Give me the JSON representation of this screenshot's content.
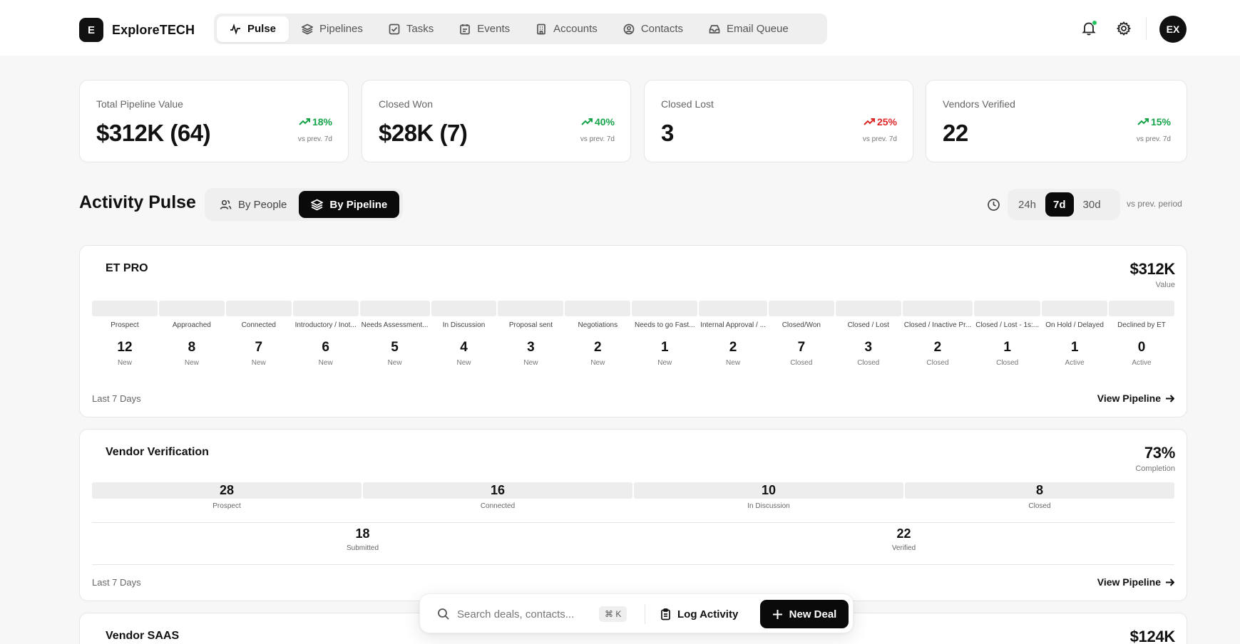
{
  "brand": {
    "logo_letter": "E",
    "name": "ExploreTECH"
  },
  "nav": [
    {
      "label": "Pulse",
      "icon": "pulse-icon",
      "active": true
    },
    {
      "label": "Pipelines",
      "icon": "layers-icon"
    },
    {
      "label": "Tasks",
      "icon": "checkbox-icon"
    },
    {
      "label": "Events",
      "icon": "calendar-icon"
    },
    {
      "label": "Accounts",
      "icon": "building-icon"
    },
    {
      "label": "Contacts",
      "icon": "contact-icon"
    },
    {
      "label": "Email Queue",
      "icon": "inbox-icon"
    }
  ],
  "header": {
    "avatar_initials": "EX",
    "icons": [
      "bell-icon",
      "gear-icon"
    ]
  },
  "kpis": [
    {
      "label": "Total Pipeline Value",
      "value": "$312K (64)",
      "trend": "18%",
      "direction": "up",
      "compare": "vs prev. 7d"
    },
    {
      "label": "Closed Won",
      "value": "$28K (7)",
      "trend": "40%",
      "direction": "up",
      "compare": "vs prev. 7d"
    },
    {
      "label": "Closed Lost",
      "value": "3",
      "trend": "25%",
      "direction": "down",
      "compare": "vs prev. 7d"
    },
    {
      "label": "Vendors Verified",
      "value": "22",
      "trend": "15%",
      "direction": "up",
      "compare": "vs prev. 7d"
    }
  ],
  "activity": {
    "title": "Activity Pulse",
    "view_toggle": [
      {
        "label": "By People",
        "icon": "people-icon",
        "active": false
      },
      {
        "label": "By Pipeline",
        "icon": "layers-icon",
        "active": true
      }
    ],
    "ranges": [
      {
        "label": "24h",
        "active": false
      },
      {
        "label": "7d",
        "active": true
      },
      {
        "label": "30d",
        "active": false
      }
    ],
    "range_note": "vs prev. period"
  },
  "pipelines": {
    "et_pro": {
      "title": "ET PRO",
      "metric_value": "$312K",
      "metric_label": "Value",
      "stages": [
        {
          "name": "Prospect",
          "count": "12",
          "status": "New"
        },
        {
          "name": "Approached",
          "count": "8",
          "status": "New"
        },
        {
          "name": "Connected",
          "count": "7",
          "status": "New"
        },
        {
          "name": "Introductory / Inot...",
          "count": "6",
          "status": "New"
        },
        {
          "name": "Needs Assessment...",
          "count": "5",
          "status": "New"
        },
        {
          "name": "In Discussion",
          "count": "4",
          "status": "New"
        },
        {
          "name": "Proposal sent",
          "count": "3",
          "status": "New"
        },
        {
          "name": "Negotiations",
          "count": "2",
          "status": "New"
        },
        {
          "name": "Needs to go Fast...",
          "count": "1",
          "status": "New"
        },
        {
          "name": "Internal Approval / ...",
          "count": "2",
          "status": "New"
        },
        {
          "name": "Closed/Won",
          "count": "7",
          "status": "Closed"
        },
        {
          "name": "Closed / Lost",
          "count": "3",
          "status": "Closed"
        },
        {
          "name": "Closed / Inactive Pr...",
          "count": "2",
          "status": "Closed"
        },
        {
          "name": "Closed / Lost - 1s:...",
          "count": "1",
          "status": "Closed"
        },
        {
          "name": "On Hold / Delayed",
          "count": "1",
          "status": "Active"
        },
        {
          "name": "Declined by ET",
          "count": "0",
          "status": "Active"
        }
      ],
      "footer": "Last 7 Days",
      "link": "View Pipeline"
    },
    "vendor_verification": {
      "title": "Vendor Verification",
      "metric_value": "73%",
      "metric_label": "Completion",
      "stages": [
        {
          "count": "28",
          "name": "Prospect"
        },
        {
          "count": "16",
          "name": "Connected"
        },
        {
          "count": "10",
          "name": "In Discussion"
        },
        {
          "count": "8",
          "name": "Closed"
        }
      ],
      "summary": [
        {
          "count": "18",
          "name": "Submitted"
        },
        {
          "count": "22",
          "name": "Verified"
        }
      ],
      "footer": "Last 7 Days",
      "link": "View Pipeline"
    },
    "vendor_saas": {
      "title": "Vendor SAAS",
      "metric_value": "$124K"
    }
  },
  "command_bar": {
    "search_placeholder": "Search deals, contacts...",
    "shortcut": "⌘ K",
    "log_label": "Log Activity",
    "new_label": "New Deal"
  }
}
